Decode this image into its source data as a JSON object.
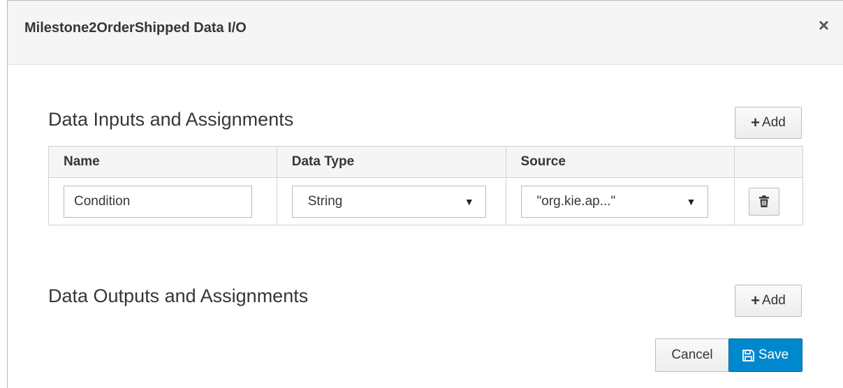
{
  "dialog": {
    "title": "Milestone2OrderShipped Data I/O",
    "close_glyph": "×"
  },
  "inputs_section": {
    "title": "Data Inputs and Assignments",
    "add_label": "Add",
    "columns": [
      "Name",
      "Data Type",
      "Source"
    ],
    "rows": [
      {
        "name": "Condition",
        "data_type": "String",
        "source": "\"org.kie.ap...\""
      }
    ]
  },
  "outputs_section": {
    "title": "Data Outputs and Assignments",
    "add_label": "Add"
  },
  "footer": {
    "cancel_label": "Cancel",
    "save_label": "Save"
  },
  "icons": {
    "close": "close-icon",
    "plus": "plus-icon",
    "trash": "trash-icon",
    "caret": "caret-down-icon",
    "save": "save-icon"
  },
  "colors": {
    "primary": "#0088ce",
    "header_bg": "#f5f5f5",
    "border": "#d1d1d1"
  }
}
